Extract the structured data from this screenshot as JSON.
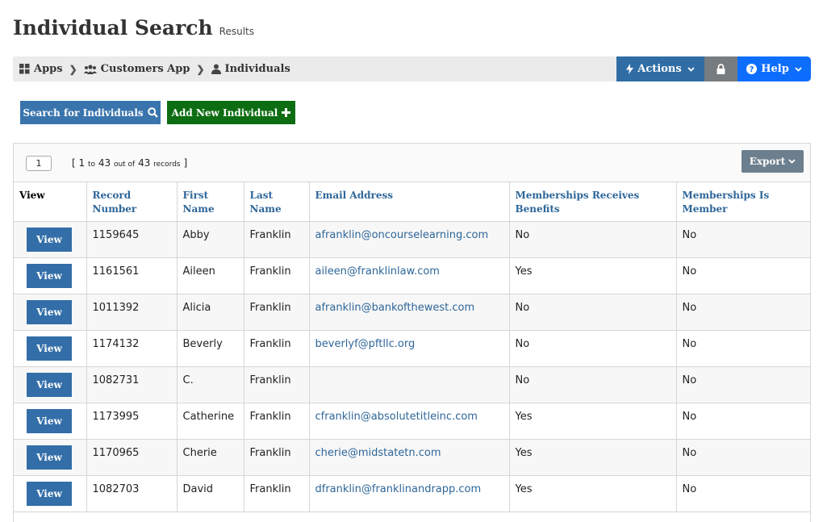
{
  "header": {
    "title": "Individual Search",
    "subtitle": "Results"
  },
  "breadcrumb": [
    {
      "label": "Apps",
      "icon": "grid-icon"
    },
    {
      "label": "Customers App",
      "icon": "users-icon"
    },
    {
      "label": "Individuals",
      "icon": "user-icon"
    }
  ],
  "toolbar": {
    "actions_label": "Actions",
    "help_label": "Help"
  },
  "buttons": {
    "search_label": "Search for Individuals",
    "add_label": "Add New Individual"
  },
  "pagination": {
    "page": "1",
    "range_open": "[ 1",
    "range_to": "to",
    "range_end": "43",
    "range_outof": "out of",
    "total": "43",
    "records": "records",
    "close": "]"
  },
  "export_label": "Export",
  "table": {
    "columns": [
      "View",
      "Record Number",
      "First Name",
      "Last Name",
      "Email Address",
      "Memberships Receives Benefits",
      "Memberships Is Member"
    ],
    "view_label": "View",
    "rows": [
      {
        "record": "1159645",
        "first": "Abby",
        "last": "Franklin",
        "email": "afranklin@oncourselearning.com",
        "benefits": "No",
        "member": "No"
      },
      {
        "record": "1161561",
        "first": "Aileen",
        "last": "Franklin",
        "email": "aileen@franklinlaw.com",
        "benefits": "Yes",
        "member": "No"
      },
      {
        "record": "1011392",
        "first": "Alicia",
        "last": "Franklin",
        "email": "afranklin@bankofthewest.com",
        "benefits": "No",
        "member": "No"
      },
      {
        "record": "1174132",
        "first": "Beverly",
        "last": "Franklin",
        "email": "beverlyf@pftllc.org",
        "benefits": "No",
        "member": "No"
      },
      {
        "record": "1082731",
        "first": "C.",
        "last": "Franklin",
        "email": "",
        "benefits": "No",
        "member": "No"
      },
      {
        "record": "1173995",
        "first": "Catherine",
        "last": "Franklin",
        "email": "cfranklin@absolutetitleinc.com",
        "benefits": "Yes",
        "member": "No"
      },
      {
        "record": "1170965",
        "first": "Cherie",
        "last": "Franklin",
        "email": "cherie@midstatetn.com",
        "benefits": "Yes",
        "member": "No"
      },
      {
        "record": "1082703",
        "first": "David",
        "last": "Franklin",
        "email": "dfranklin@franklinandrapp.com",
        "benefits": "Yes",
        "member": "No"
      }
    ]
  }
}
